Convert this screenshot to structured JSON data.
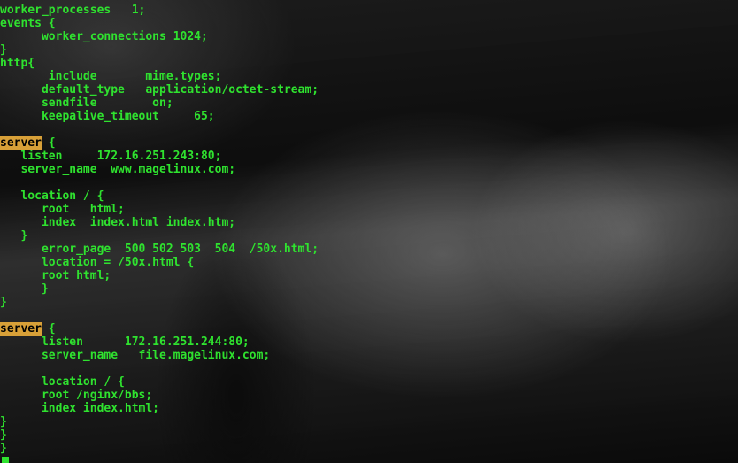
{
  "config": {
    "line01": "worker_processes   1;",
    "line02": "events {",
    "line03": "      worker_connections 1024;",
    "line04": "}",
    "line05": "http{",
    "line06": "       include       mime.types;",
    "line07": "      default_type   application/octet-stream;",
    "line08": "      sendfile        on;",
    "line09": "      keepalive_timeout     65;",
    "server1_label": "server",
    "line10_rest": " {",
    "line11": "   listen     172.16.251.243:80;",
    "line12": "   server_name  www.magelinux.com;",
    "line13": "   location / {",
    "line14": "      root   html;",
    "line15": "      index  index.html index.htm;",
    "line16": "   }",
    "line17": "      error_page  500 502 503  504  /50x.html;",
    "line18": "      location = /50x.html {",
    "line19": "      root html;",
    "line20": "      }",
    "line21": "}",
    "server2_label": "server",
    "line22_rest": " {",
    "line23": "      listen      172.16.251.244:80;",
    "line24": "      server_name   file.magelinux.com;",
    "line25": "      location / {",
    "line26": "      root /nginx/bbs;",
    "line27": "      index index.html;",
    "line28": "}",
    "line29": "}",
    "line30": "}"
  }
}
